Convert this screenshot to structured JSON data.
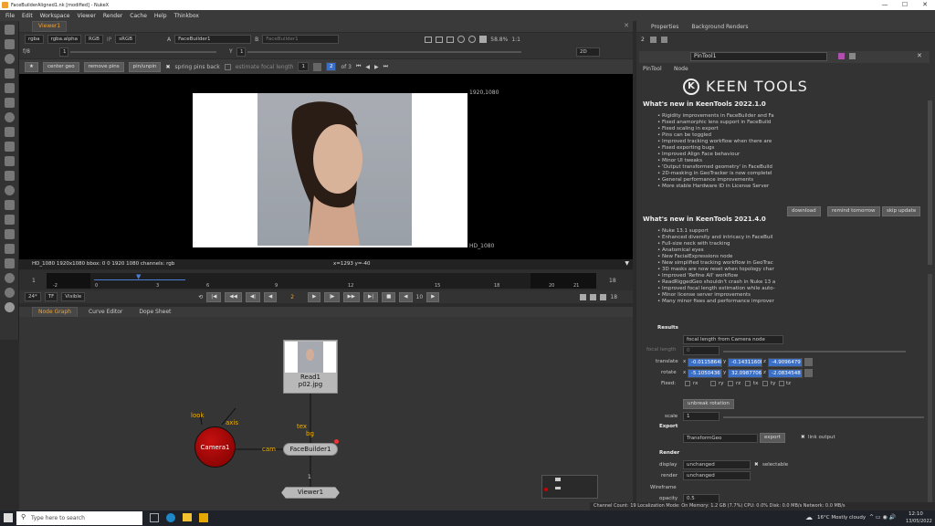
{
  "window": {
    "title": "FaceBuilderAligned1.nk [modified] - NukeX",
    "min": "—",
    "max": "☐",
    "close": "✕"
  },
  "menu": [
    "File",
    "Edit",
    "Workspace",
    "Viewer",
    "Render",
    "Cache",
    "Help",
    "Thinkbox"
  ],
  "viewer": {
    "tab": "Viewer1",
    "channels": "rgba",
    "alpha": "rgba.alpha",
    "rgb": "RGB",
    "ip": "IP",
    "colorspace": "sRGB",
    "input_a_label": "A",
    "input_a": "FaceBuilder1",
    "input_b_label": "B",
    "input_b": "FaceBuilder1",
    "fstop": "f/8",
    "frame_field": "1",
    "y_label": "Y",
    "y_field": "1",
    "zoom_pct": "58.8%",
    "ratio": "1:1",
    "mode": "2D",
    "fb_buttons": [
      "center geo",
      "remove pins",
      "pin/unpin"
    ],
    "spring_pins": "spring pins back",
    "estimate_focal": "estimate focal length",
    "kf_value": "1",
    "page_current": "2",
    "page_of": "of 3",
    "size_label_top": "1920,1080",
    "size_label_bottom": "HD_1080",
    "info_left": "HD_1080 1920x1080  bbox: 0 0 1920 1080 channels: rgb",
    "info_coord": "x=1293 y=-40"
  },
  "timeline": {
    "start": "1",
    "end": "18",
    "ticks": [
      "-2",
      "0",
      "3",
      "6",
      "9",
      "12",
      "15",
      "18",
      "20",
      "21"
    ],
    "fps": "24*",
    "tf": "TF",
    "visible": "Visible",
    "frame": "2",
    "step": "10",
    "end2": "18"
  },
  "nodegraph": {
    "tabs": [
      "Node Graph",
      "Curve Editor",
      "Dope Sheet"
    ],
    "read_node": "Read1",
    "read_file": "p02.jpg",
    "camera": "Camera1",
    "look": "look",
    "axis": "axis",
    "cam": "cam",
    "tex": "tex",
    "bg": "bg",
    "facebuilder": "FaceBuilder1",
    "input_num": "1",
    "viewer": "Viewer1"
  },
  "properties": {
    "tabs": [
      "Properties",
      "Background Renders"
    ],
    "node_name": "PinTool1",
    "subtabs": [
      "PinTool",
      "Node"
    ],
    "logo_text": "KEEN TOOLS",
    "whats_new_1": "What's new in KeenTools 2022.1.0",
    "bullets_1": [
      "• Rigidity improvements in FaceBuilder and Fa",
      "• Fixed anamorphic lens support in FaceBuild",
      "• Fixed scaling in export",
      "• Pins can be toggled",
      "• Improved tracking workflow when there are",
      "• Fixed exporting bugs",
      "• Improved Align Face behaviour",
      "• Minor UI tweaks",
      "• 'Output transformed geometry' in FaceBuild",
      "• 2D-masking in GeoTracker is now completel",
      "• General performance improvements",
      "• More stable Hardware ID in License Server"
    ],
    "update_buttons": [
      "download",
      "remind tomorrow",
      "skip update"
    ],
    "whats_new_2": "What's new in KeenTools 2021.4.0",
    "bullets_2": [
      "• Nuke 13.1 support",
      "• Enhanced diversity and intricacy in FaceBuil",
      "• Full-size neck with tracking",
      "• Anatomical eyes",
      "• New FacialExpressions node",
      "• New simplified tracking workflow in GeoTrac",
      "• 3D masks are now reset when topology char",
      "• Improved 'Refine All' workflow",
      "• ReadRiggedGeo shouldn't crash in Nuke 13 a",
      "• Improved focal length estimation while auto-",
      "• Minor license server improvements",
      "• Many minor fixes and performance improver"
    ],
    "results_label": "Results",
    "focal_mode": "focal length from Camera node",
    "focal_label": "focal length",
    "focal_value": "0",
    "translate_label": "translate",
    "tx": "-0.01158648",
    "ty": "-0.1431160E",
    "tz": "-4.9096479",
    "rotate_label": "rotate",
    "rx": "-5.1050436",
    "ry": "32.0987706",
    "rz": "-2.0834548",
    "axis_x": "x",
    "axis_y": "y",
    "axis_z": "z",
    "fixed_label": "Fixed:",
    "fixed_items": [
      "rx",
      "ry",
      "rz",
      "tx",
      "ty",
      "tz"
    ],
    "unbreak": "unbreak rotation",
    "scale_label": "scale",
    "scale_value": "1",
    "export_label": "Export",
    "export_mode": "TransformGeo",
    "export_btn": "export",
    "link_output": "link output",
    "render_label": "Render",
    "display_label": "display",
    "display_value": "unchanged",
    "selectable": "selectable",
    "render_row_label": "render",
    "render_value": "unchanged",
    "wireframe_label": "Wireframe",
    "opacity_label": "opacity",
    "opacity_value": "0.5"
  },
  "status": "Channel Count: 19  Localization Mode: On  Memory: 1.2 GB (7.7%)  CPU: 0.0%  Disk: 0.0 MB/s  Network: 0.0 MB/s",
  "taskbar": {
    "search": "Type here to search",
    "weather": "16°C  Mostly cloudy",
    "time": "12:10",
    "date": "13/05/2022"
  }
}
